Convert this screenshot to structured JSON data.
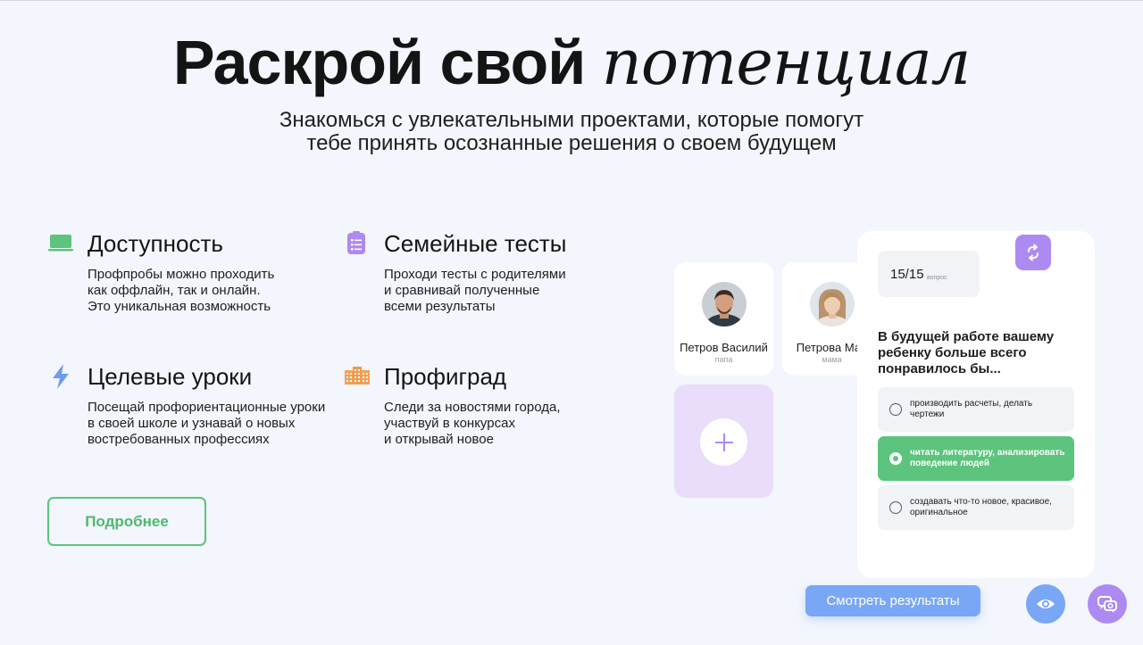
{
  "hero": {
    "title_bold": "Раскрой свой",
    "title_italic": "потенциал",
    "subtitle_line1": "Знакомься с увлекательными проектами, которые помогут",
    "subtitle_line2": "тебе принять осознанные решения о своем будущем"
  },
  "features": [
    {
      "icon": "laptop-icon",
      "title": "Доступность",
      "lines": [
        "Профпробы можно проходить",
        "как оффлайн, так и онлайн.",
        "Это уникальная возможность"
      ]
    },
    {
      "icon": "clipboard-icon",
      "title": "Семейные тесты",
      "lines": [
        "Проходи тесты с родителями",
        "и сравнивай полученные",
        "всеми результаты"
      ]
    },
    {
      "icon": "lightning-icon",
      "title": "Целевые уроки",
      "lines": [
        "Посещай профориентационные уроки",
        "в своей школе и узнавай о новых",
        "востребованных профессиях"
      ]
    },
    {
      "icon": "building-icon",
      "title": "Профиград",
      "lines": [
        "Следи за новостями города,",
        "участвуй в конкурсах",
        "и открывай новое"
      ]
    }
  ],
  "more_button": "Подробнее",
  "participants": [
    {
      "name": "Петров Василий",
      "role": "папа"
    },
    {
      "name": "Петрова Мар",
      "role": "мама"
    }
  ],
  "quiz": {
    "counter": "15/15",
    "counter_label": "вопрос",
    "question_lines": [
      "В будущей работе вашему",
      "ребенку больше всего",
      "понравилось бы..."
    ],
    "options": [
      {
        "lines": [
          "производить расчеты, делать",
          "чертежи"
        ],
        "selected": false
      },
      {
        "lines": [
          "читать литературу, анализировать",
          "поведение людей"
        ],
        "selected": true
      },
      {
        "lines": [
          "создавать что-то новое, красивое,",
          "оригинальное"
        ],
        "selected": false
      }
    ]
  },
  "results_button": "Смотреть результаты",
  "colors": {
    "accent_green": "#5cc47c",
    "accent_purple": "#ad8af2",
    "accent_blue": "#7aa7f5",
    "background": "#f3f6fc"
  }
}
